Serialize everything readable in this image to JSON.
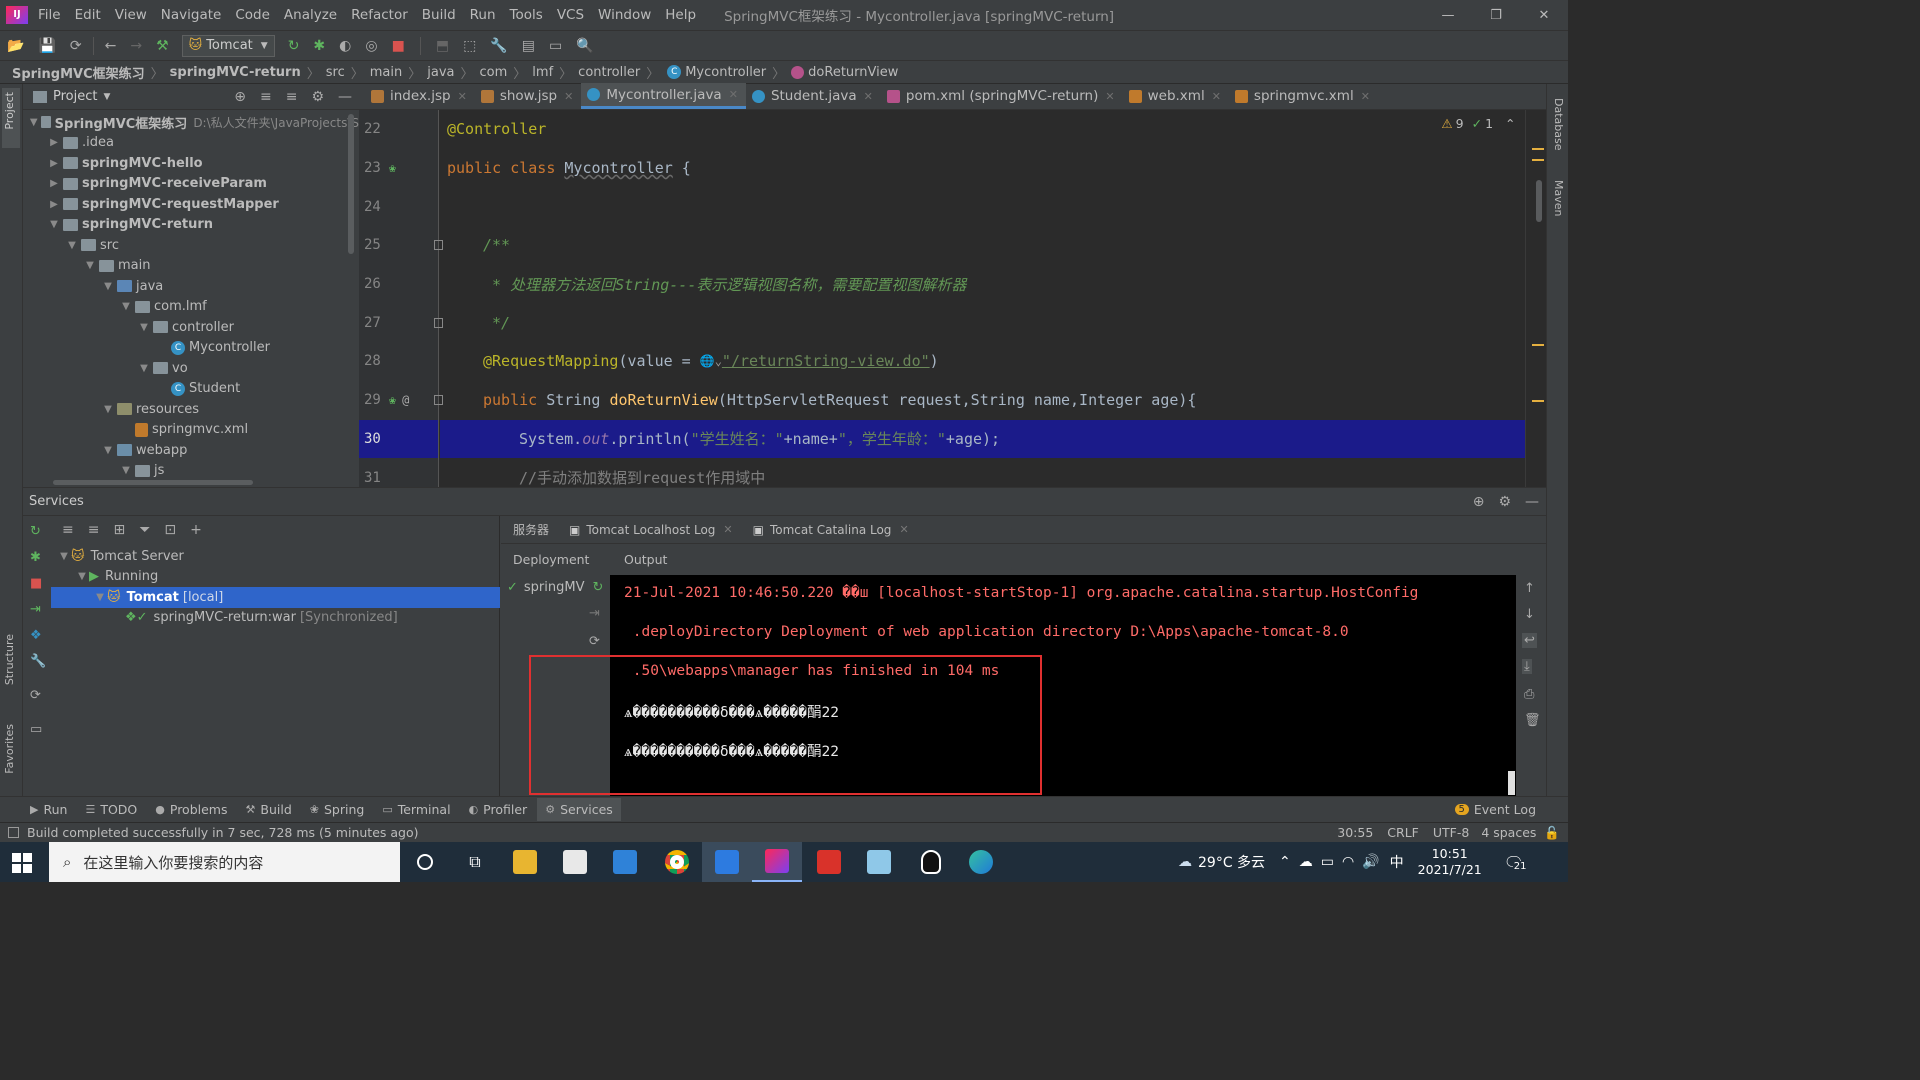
{
  "window": {
    "title": "SpringMVC框架练习 - Mycontroller.java [springMVC-return]",
    "logo": "IJ"
  },
  "menu": [
    "File",
    "Edit",
    "View",
    "Navigate",
    "Code",
    "Analyze",
    "Refactor",
    "Build",
    "Run",
    "Tools",
    "VCS",
    "Window",
    "Help"
  ],
  "toolbar": {
    "run_config": "Tomcat"
  },
  "breadcrumb": [
    "SpringMVC框架练习",
    "springMVC-return",
    "src",
    "main",
    "java",
    "com",
    "lmf",
    "controller",
    "Mycontroller",
    "doReturnView"
  ],
  "project": {
    "title": "Project",
    "tree": [
      {
        "label": "SpringMVC框架练习",
        "extra": "D:\\私人文件夹\\JavaProjects\\S",
        "level": 0,
        "arrow": "down",
        "icon": "module",
        "bold": true
      },
      {
        "label": ".idea",
        "level": 1,
        "arrow": "right",
        "icon": "folder"
      },
      {
        "label": "springMVC-hello",
        "level": 1,
        "arrow": "right",
        "icon": "module",
        "bold": true
      },
      {
        "label": "springMVC-receiveParam",
        "level": 1,
        "arrow": "right",
        "icon": "module",
        "bold": true
      },
      {
        "label": "springMVC-requestMapper",
        "level": 1,
        "arrow": "right",
        "icon": "module",
        "bold": true
      },
      {
        "label": "springMVC-return",
        "level": 1,
        "arrow": "down",
        "icon": "module",
        "bold": true
      },
      {
        "label": "src",
        "level": 2,
        "arrow": "down",
        "icon": "folder"
      },
      {
        "label": "main",
        "level": 3,
        "arrow": "down",
        "icon": "folder"
      },
      {
        "label": "java",
        "level": 4,
        "arrow": "down",
        "icon": "src"
      },
      {
        "label": "com.lmf",
        "level": 5,
        "arrow": "down",
        "icon": "folder"
      },
      {
        "label": "controller",
        "level": 6,
        "arrow": "down",
        "icon": "folder"
      },
      {
        "label": "Mycontroller",
        "level": 7,
        "arrow": "",
        "icon": "class"
      },
      {
        "label": "vo",
        "level": 6,
        "arrow": "down",
        "icon": "folder"
      },
      {
        "label": "Student",
        "level": 7,
        "arrow": "",
        "icon": "class"
      },
      {
        "label": "resources",
        "level": 4,
        "arrow": "down",
        "icon": "res"
      },
      {
        "label": "springmvc.xml",
        "level": 5,
        "arrow": "",
        "icon": "xml"
      },
      {
        "label": "webapp",
        "level": 4,
        "arrow": "down",
        "icon": "web"
      },
      {
        "label": "js",
        "level": 5,
        "arrow": "down",
        "icon": "folder"
      }
    ]
  },
  "tabs": [
    {
      "label": "index.jsp",
      "icon": "jsp",
      "active": false
    },
    {
      "label": "show.jsp",
      "icon": "jsp",
      "active": false
    },
    {
      "label": "Mycontroller.java",
      "icon": "class",
      "active": true
    },
    {
      "label": "Student.java",
      "icon": "class",
      "active": false
    },
    {
      "label": "pom.xml (springMVC-return)",
      "icon": "maven",
      "active": false
    },
    {
      "label": "web.xml",
      "icon": "xml",
      "active": false
    },
    {
      "label": "springmvc.xml",
      "icon": "xml",
      "active": false
    }
  ],
  "inspections": {
    "warnings": "9",
    "checks": "1"
  },
  "code": {
    "line_numbers": [
      "22",
      "23",
      "24",
      "25",
      "26",
      "27",
      "28",
      "29",
      "30",
      "31"
    ],
    "l22": "@Controller",
    "l23_kw": "public class ",
    "l23_name": "Mycontroller",
    "l23_rest": " {",
    "l25": "/**",
    "l26": " * 处理器方法返回String---表示逻辑视图名称，需要配置视图解析器",
    "l27": " */",
    "l28_ann": "@RequestMapping",
    "l28_a": "(value = ",
    "l28_url": "\"/returnString-view.do\"",
    "l28_b": ")",
    "l29_kw": "public ",
    "l29_type": "String ",
    "l29_fn": "doReturnView",
    "l29_args": "(HttpServletRequest request,String name,Integer age){",
    "l30_a": "System.",
    "l30_out": "out",
    "l30_b": ".println(",
    "l30_s1": "\"学生姓名：\"",
    "l30_c": "+name+",
    "l30_s2": "\"，学生年龄：\"",
    "l30_d": "+age);",
    "l31": "//手动添加数据到request作用域中"
  },
  "services": {
    "title": "Services",
    "tree": [
      {
        "label": "Tomcat Server",
        "level": 0,
        "arrow": "down"
      },
      {
        "label": "Running",
        "level": 1,
        "arrow": "down"
      },
      {
        "label": "Tomcat",
        "extra": "[local]",
        "level": 2,
        "arrow": "down",
        "selected": true
      },
      {
        "label": "springMVC-return:war",
        "extra": "[Synchronized]",
        "level": 3,
        "arrow": ""
      }
    ],
    "tabs": [
      "服务器",
      "Tomcat Localhost Log",
      "Tomcat Catalina Log"
    ],
    "deployment_label": "Deployment",
    "output_label": "Output",
    "deployment_item": "springMV",
    "console": [
      "21-Jul-2021 10:46:50.220 ��ш [localhost-startStop-1] org.apache.catalina.startup.HostConfig",
      " .deployDirectory Deployment of web application directory D:\\Apps\\apache-tomcat-8.0",
      " .50\\webapps\\manager has finished in 104 ms",
      "ѧ����������δ���ѧ�����䣺22",
      "ѧ����������δ���ѧ�����䣺22"
    ]
  },
  "bottom_tools": [
    "Run",
    "TODO",
    "Problems",
    "Build",
    "Spring",
    "Terminal",
    "Profiler",
    "Services"
  ],
  "event_log": {
    "count": "5",
    "label": "Event Log"
  },
  "status": {
    "message": "Build completed successfully in 7 sec, 728 ms (5 minutes ago)",
    "position": "30:55",
    "line_sep": "CRLF",
    "encoding": "UTF-8",
    "indent": "4 spaces"
  },
  "taskbar": {
    "search_placeholder": "在这里输入你要搜索的内容",
    "weather": "29°C 多云",
    "ime": "中",
    "time": "10:51",
    "date": "2021/7/21",
    "notification_count": "21"
  },
  "side_labels": {
    "left_top": "Project",
    "left_mid": "Structure",
    "left_bottom": "Favorites",
    "right_top": "Database",
    "right_mid": "Maven"
  }
}
